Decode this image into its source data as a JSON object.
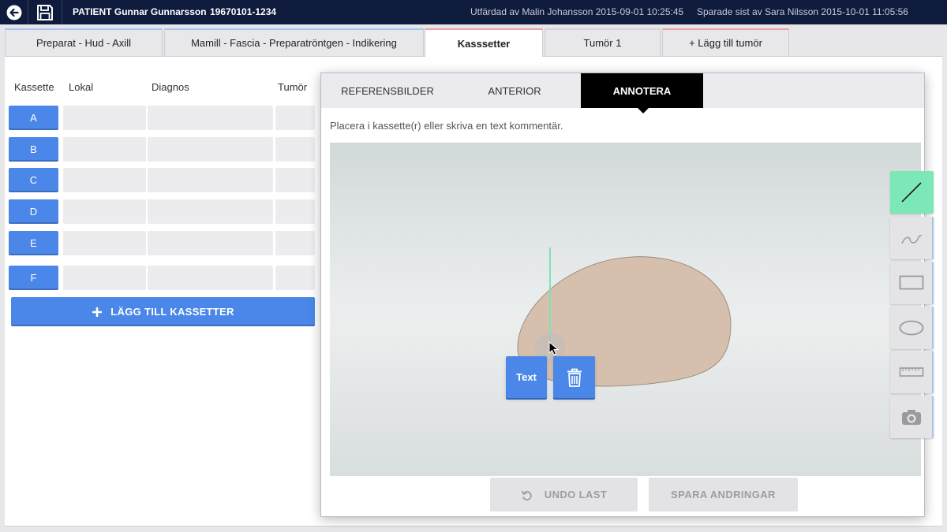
{
  "topbar": {
    "back_icon": "back-arrow-icon",
    "save_icon": "floppy-disk-icon",
    "patient_name": "PATIENT Gunnar Gunnarsson",
    "patient_id": "19670101-1234",
    "issued_by": "Utfärdad av Malin Johansson 2015-09-01 10:25:45",
    "saved_by": "Sparade sist av Sara Nilsson 2015-10-01 11:05:56"
  },
  "tabs": [
    {
      "label": "Preparat - Hud - Axill",
      "active": false
    },
    {
      "label": "Mamill - Fascia - Preparatröntgen - Indikering",
      "active": false
    },
    {
      "label": "Kasssetter",
      "active": true
    },
    {
      "label": "Tumör 1",
      "active": false
    },
    {
      "label": "+ Lägg till tumör",
      "active": false
    }
  ],
  "cassettes": {
    "headers": {
      "kassette": "Kassette",
      "lokal": "Lokal",
      "diagnos": "Diagnos",
      "tumor": "Tumör"
    },
    "rows": [
      {
        "label": "A"
      },
      {
        "label": "B"
      },
      {
        "label": "C"
      },
      {
        "label": "D"
      },
      {
        "label": "E"
      },
      {
        "label": "F"
      }
    ],
    "add_button": {
      "icon": "plus-icon",
      "label": "LÄGG TILL KASSETTER"
    }
  },
  "annotation_panel": {
    "tabs": [
      {
        "label": "REFERENSBILDER",
        "active": false
      },
      {
        "label": "ANTERIOR",
        "active": false
      },
      {
        "label": "ANNOTERA",
        "active": true
      }
    ],
    "instruction": "Placera i kassette(r) eller skriva en text kommentär.",
    "canvas": {
      "text_button": "Text",
      "delete_icon": "trash-icon",
      "cursor_icon": "mouse-pointer-icon"
    },
    "undo_button": {
      "icon": "undo-icon",
      "label": "UNDO LAST",
      "enabled": false
    },
    "save_button": {
      "label": "SPARA ANDRINGAR",
      "enabled": false
    }
  },
  "tools": [
    {
      "icon": "line-icon",
      "active": true
    },
    {
      "icon": "freehand-squiggle-icon",
      "active": false
    },
    {
      "icon": "rectangle-icon",
      "active": false
    },
    {
      "icon": "ellipse-icon",
      "active": false
    },
    {
      "icon": "ruler-icon",
      "active": false
    },
    {
      "icon": "camera-icon",
      "active": false
    }
  ],
  "colors": {
    "topbar_background": "#0e1b3d",
    "primary_button": "#4a87e8",
    "active_tool": "#7de8b7",
    "annotation_line": "#80e0b6",
    "specimen_fill": "#d6bfac"
  }
}
